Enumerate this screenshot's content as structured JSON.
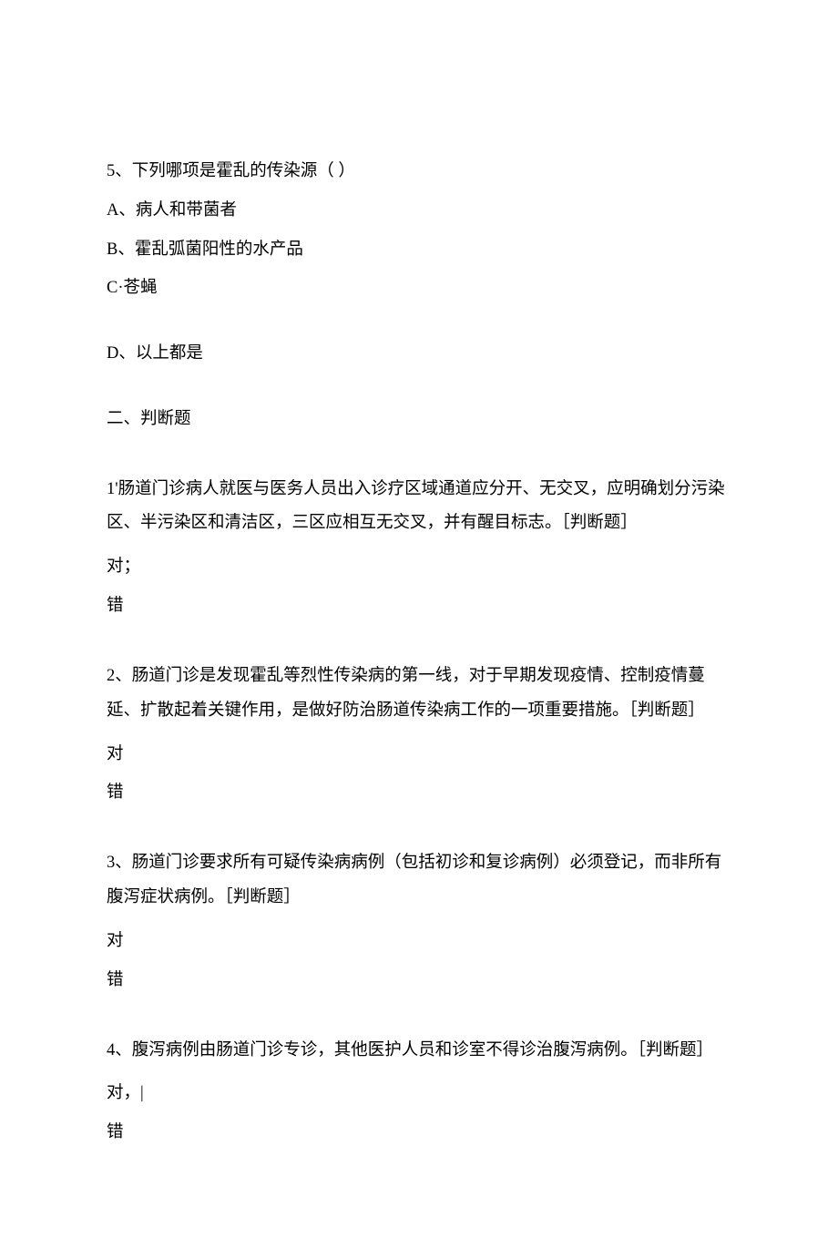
{
  "question5": {
    "stem": "5、下列哪项是霍乱的传染源（ ）",
    "optA": "A、病人和带菌者",
    "optB": "B、霍乱弧菌阳性的水产品",
    "optC": "C·苍蝇",
    "optD": "D、以上都是"
  },
  "section2_heading": "二、判断题",
  "judge1": {
    "text": "1'肠道门诊病人就医与医务人员出入诊疗区域通道应分开、无交叉，应明确划分污染区、半污染区和清洁区，三区应相互无交叉，并有醒目标志。［判断题］",
    "opt_true": "对；",
    "opt_false": "错"
  },
  "judge2": {
    "text": "2、肠道门诊是发现霍乱等烈性传染病的第一线，对于早期发现疫情、控制疫情蔓延、扩散起着关键作用，是做好防治肠道传染病工作的一项重要措施。［判断题］",
    "opt_true": "对",
    "opt_false": "错"
  },
  "judge3": {
    "text": "3、肠道门诊要求所有可疑传染病病例（包括初诊和复诊病例）必须登记，而非所有腹泻症状病例。［判断题］",
    "opt_true": "对",
    "opt_false": "错"
  },
  "judge4": {
    "text": "4、腹泻病例由肠道门诊专诊，其他医护人员和诊室不得诊治腹泻病例。［判断题］",
    "opt_true": "对，|",
    "opt_false": "错"
  }
}
